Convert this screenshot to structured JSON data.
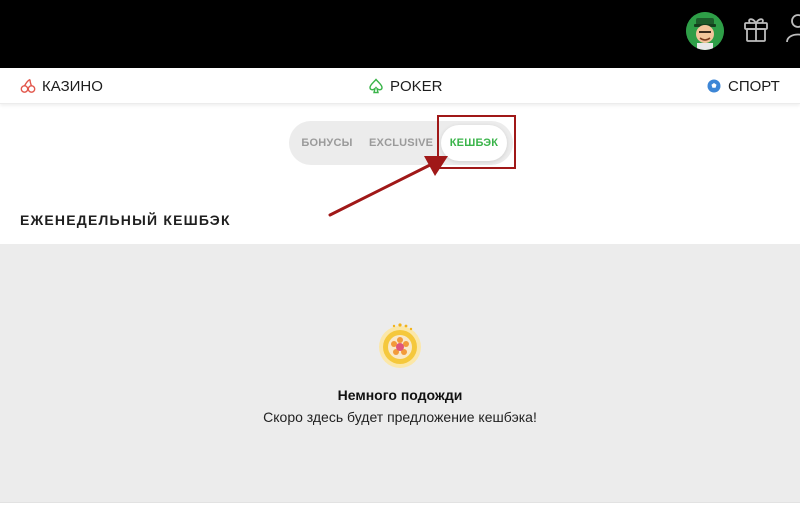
{
  "nav": {
    "casino": "КАЗИНО",
    "poker": "POKER",
    "sport": "СПОРТ"
  },
  "tabs": [
    {
      "label": "БОНУСЫ",
      "active": false
    },
    {
      "label": "EXCLUSIVE",
      "active": false
    },
    {
      "label": "КЕШБЭК",
      "active": true
    }
  ],
  "section": {
    "title": "ЕЖЕНЕДЕЛЬНЫЙ КЕШБЭК"
  },
  "empty_state": {
    "title": "Немного подожди",
    "text": "Скоро здесь будет предложение кешбэка!"
  },
  "colors": {
    "topbar": "#000000",
    "accent_green": "#3ab44a",
    "annotation_red": "#a01818",
    "content_bg": "#ececec",
    "loader_gold": "#f2b31a"
  },
  "icons": [
    "avatar-icon",
    "gift-icon",
    "user-icon",
    "cherry-icon",
    "spade-icon",
    "soccer-ball-icon",
    "sunflower-loader-icon"
  ]
}
